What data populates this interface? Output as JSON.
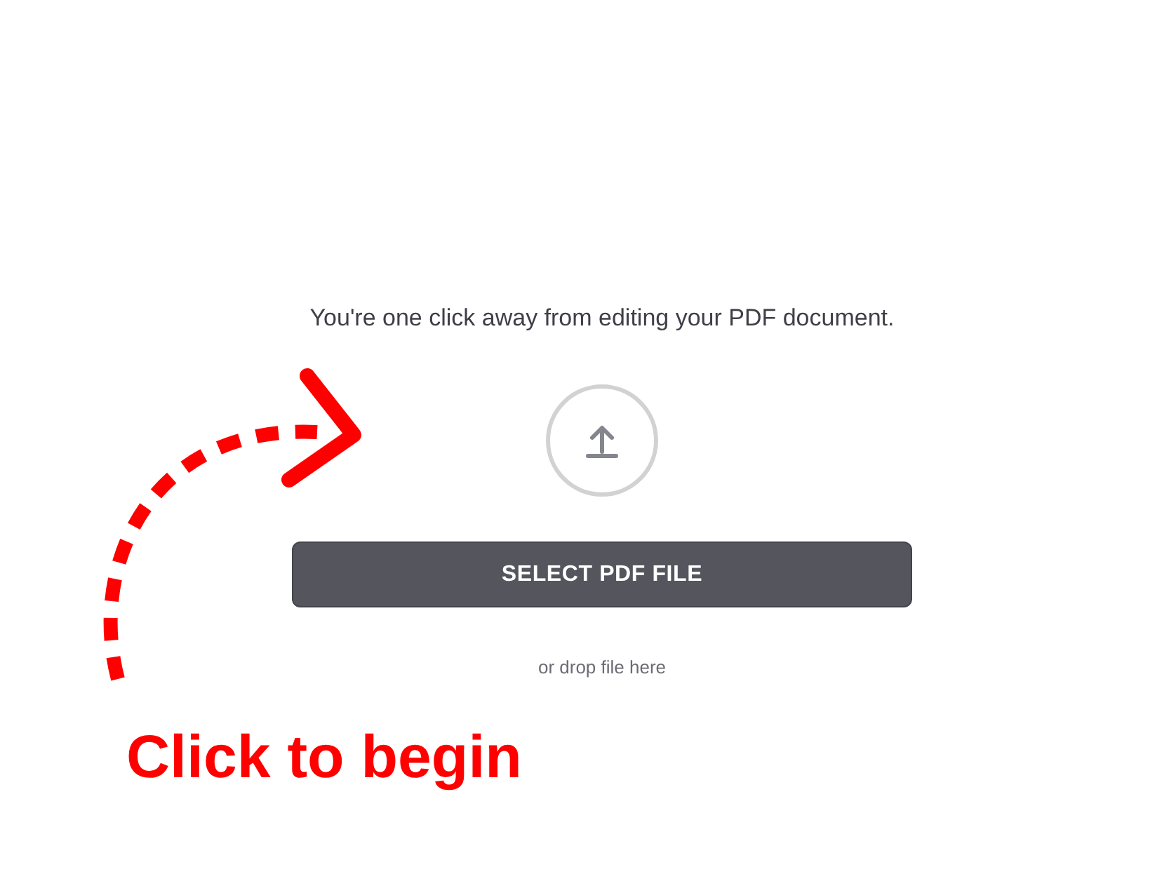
{
  "prompt": "You're one click away from editing your PDF document.",
  "upload_button": {
    "label": "SELECT PDF FILE"
  },
  "drop_hint": "or drop file here",
  "annotation": {
    "text": "Click to begin"
  }
}
